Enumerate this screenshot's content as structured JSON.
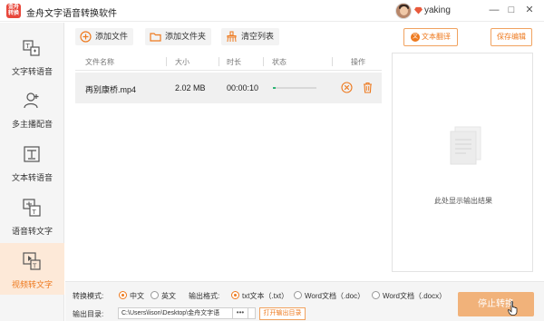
{
  "titlebar": {
    "logo_text": "金舟\n转换",
    "app_title": "金舟文字语音转换软件",
    "username": "yaking",
    "minimize": "—",
    "maximize": "□",
    "close": "✕",
    "vip_icon": "diamond-icon"
  },
  "sidebar": {
    "items": [
      {
        "label": "文字转语音",
        "icon": "text-to-speech-icon",
        "active": false
      },
      {
        "label": "多主播配音",
        "icon": "multi-speaker-icon",
        "active": false
      },
      {
        "label": "文本转语音",
        "icon": "document-to-speech-icon",
        "active": false
      },
      {
        "label": "语音转文字",
        "icon": "speech-to-text-icon",
        "active": false
      },
      {
        "label": "视频转文字",
        "icon": "video-to-text-icon",
        "active": true
      }
    ]
  },
  "toolbar": {
    "add_file": "添加文件",
    "add_folder": "添加文件夹",
    "clear_list": "清空列表",
    "translate": "文本翻译",
    "save_edit": "保存编辑"
  },
  "table": {
    "headers": {
      "name": "文件名称",
      "size": "大小",
      "duration": "时长",
      "status": "状态",
      "actions": "操作"
    },
    "rows": [
      {
        "name": "再别康桥.mp4",
        "size": "2.02 MB",
        "duration": "00:00:10",
        "progress": 0.06
      }
    ]
  },
  "output": {
    "placeholder": "此处显示输出结果"
  },
  "bottom": {
    "mode_label": "转换模式:",
    "mode_options": [
      "中文",
      "英文"
    ],
    "mode_selected": 0,
    "format_label": "输出格式:",
    "format_options": [
      "txt文本（.txt）",
      "Word文档（.doc）",
      "Word文档（.docx）"
    ],
    "format_selected": 0,
    "dir_label": "输出目录:",
    "dir_value": "C:\\Users\\lison\\Desktop\\金舟文字语",
    "more": "•••",
    "open_dir": "打开输出目录",
    "stop_button": "停止转换"
  },
  "colors": {
    "accent": "#ee7a1f",
    "accent_light": "#f1b27a",
    "progress": "#2cb574",
    "active_sidebar_bg": "#fde9d8"
  }
}
